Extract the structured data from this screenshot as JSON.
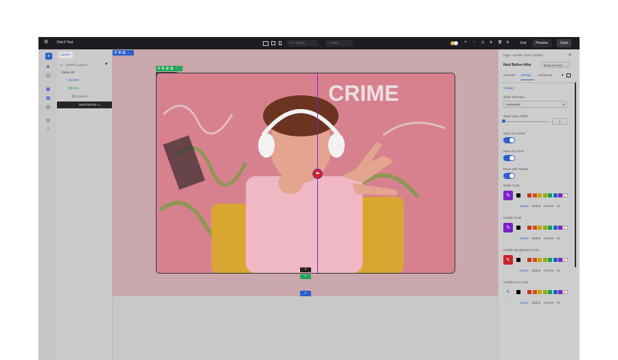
{
  "topbar": {
    "title": "Divi-5 Test",
    "width_value": "1280px",
    "zoom_value": "100%",
    "exit_label": "Exit",
    "preview_label": "Preview",
    "save_label": "Save"
  },
  "layers": {
    "tab_label": "Layers",
    "search_placeholder": "Search Layout",
    "close_all_label": "Close All",
    "items": [
      {
        "label": "Section"
      },
      {
        "label": "Row"
      },
      {
        "label": "Column"
      },
      {
        "label": "Next Before A..."
      }
    ]
  },
  "settings": {
    "breadcrumb": "Page › Section › Row › Column",
    "module_title": "Next Before After",
    "preset_label": "Default Preset",
    "tabs": [
      "Content",
      "Design",
      "Advanced"
    ],
    "active_tab": "Design",
    "group_title": "Slider",
    "slider_direction_label": "Slider Direction",
    "slider_direction_value": "Horizontal",
    "start_offset_label": "Slider Start Offset",
    "start_offset_value": "0",
    "start_offset_fraction": 0,
    "move_on_hover_label": "Move On Hover",
    "move_on_click_label": "Move On Click",
    "move_with_handle_label": "Move with Handle",
    "move_on_hover_on": true,
    "move_on_click_on": true,
    "move_with_handle_on": true,
    "color_groups": [
      {
        "label": "Slider Color",
        "color": "#7a22c8"
      },
      {
        "label": "Handle Color",
        "color": "#7a22c8"
      },
      {
        "label": "Handle Background Color",
        "color": "#c8242a"
      },
      {
        "label": "Handle Icon Color",
        "color": "#1f5fcf"
      }
    ],
    "saved_label": "Saved",
    "global_label": "Global",
    "recent_label": "Recent",
    "swatch_colors": [
      "#c0392b",
      "#d35400",
      "#c9a40a",
      "#8fb017",
      "#1e9c4e",
      "#1f5fcf",
      "#7a22c8"
    ]
  },
  "canvas": {
    "graffiti_text": "CRIME"
  },
  "colors": {
    "accent_blue": "#2b5fcb",
    "module_green": "#25a45a",
    "divider_purple": "#7a22c8",
    "handle_red": "#c8242a"
  }
}
